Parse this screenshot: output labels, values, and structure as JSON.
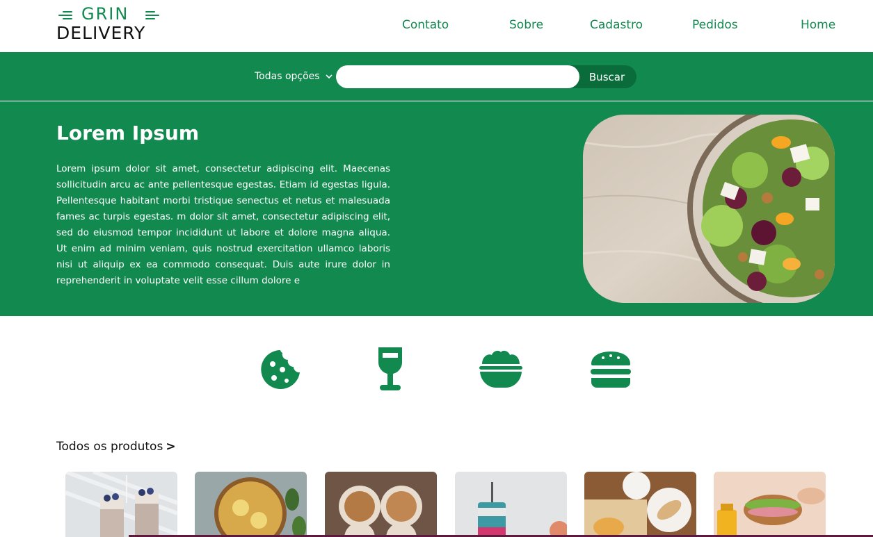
{
  "brand": {
    "line1": "GRIN",
    "line2": "DELIVERY",
    "accent": "#11894f"
  },
  "nav": [
    {
      "label": "Contato"
    },
    {
      "label": "Sobre"
    },
    {
      "label": "Cadastro"
    },
    {
      "label": "Pedidos"
    },
    {
      "label": "Home"
    }
  ],
  "search": {
    "options_label": "Todas opções",
    "options_icon": "chevron-down-icon",
    "value": "",
    "placeholder": "",
    "button_label": "Buscar"
  },
  "hero": {
    "title": "Lorem Ipsum",
    "text": "Lorem ipsum dolor sit amet, consectetur adipiscing elit. Maecenas sollicitudin arcu ac ante pellentesque egestas. Etiam id egestas ligula. Pellentesque habitant morbi tristique senectus et netus et malesuada fames ac turpis egestas. m dolor sit amet, consectetur adipiscing elit, sed do eiusmod tempor incididunt ut labore et dolore magna aliqua. Ut enim ad minim veniam, quis nostrud exercitation ullamco laboris nisi ut aliquip ex ea commodo consequat. Duis aute irure dolor in reprehenderit in voluptate velit esse cillum dolore e",
    "image": "salad-bowl-image"
  },
  "categories": [
    {
      "icon": "cookie-icon"
    },
    {
      "icon": "wine-glass-icon"
    },
    {
      "icon": "salad-bowl-icon"
    },
    {
      "icon": "burger-icon"
    }
  ],
  "products_section": {
    "title": "Todos os produtos",
    "arrow": ">"
  },
  "products": [
    {
      "image": "blueberry-parfait-image"
    },
    {
      "image": "lemon-tea-image"
    },
    {
      "image": "coffee-cups-image"
    },
    {
      "image": "tumbler-cup-image"
    },
    {
      "image": "pastry-plate-image"
    },
    {
      "image": "sandwich-juice-image"
    }
  ],
  "colors": {
    "primary": "#11894f",
    "button_dark": "#0a6b3b",
    "white": "#ffffff"
  }
}
